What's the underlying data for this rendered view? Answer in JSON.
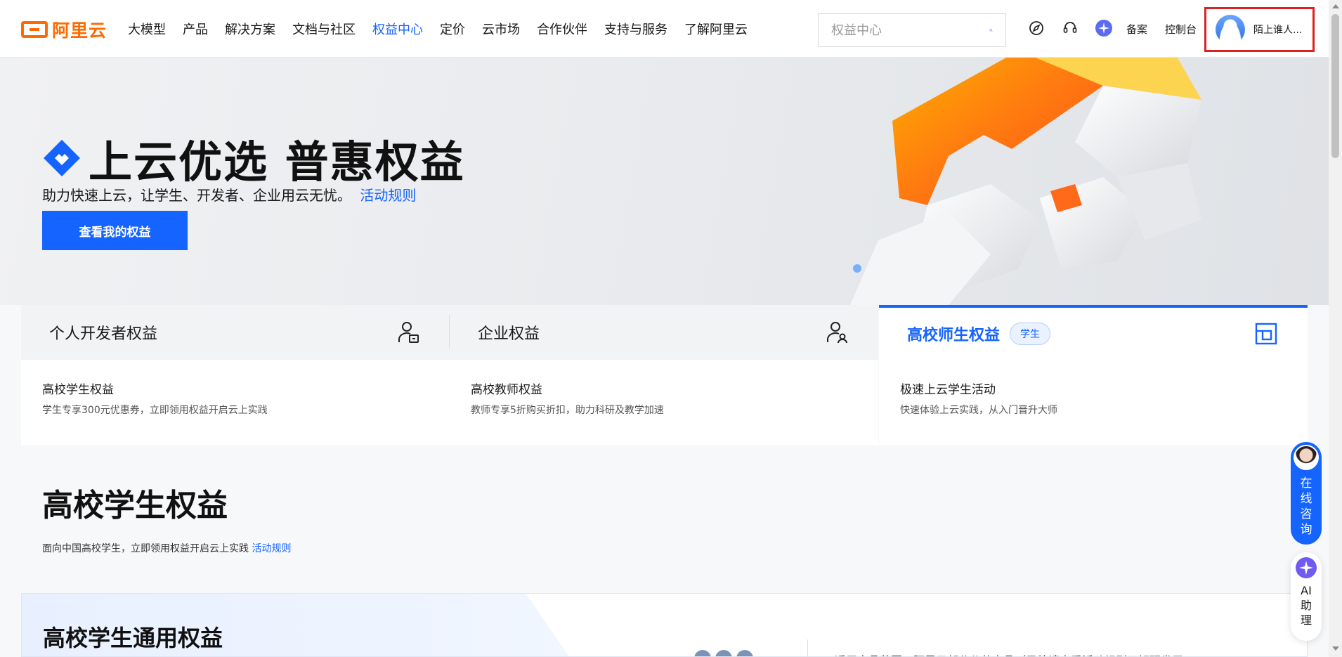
{
  "header": {
    "logo_text": "阿里云",
    "nav": [
      {
        "label": "大模型"
      },
      {
        "label": "产品"
      },
      {
        "label": "解决方案"
      },
      {
        "label": "文档与社区"
      },
      {
        "label": "权益中心",
        "active": true
      },
      {
        "label": "定价"
      },
      {
        "label": "云市场"
      },
      {
        "label": "合作伙伴"
      },
      {
        "label": "支持与服务"
      },
      {
        "label": "了解阿里云"
      }
    ],
    "search": {
      "placeholder": "权益中心",
      "value": ""
    },
    "icons": [
      "explore-icon",
      "support-icon",
      "ai-assistant-icon"
    ],
    "beian_label": "备案",
    "console_label": "控制台",
    "user_name": "陌上谁人..."
  },
  "hero": {
    "title": "上云优选  普惠权益",
    "subtitle": "助力快速上云，让学生、开发者、企业用云无忧。",
    "rules_link": "活动规则",
    "cta_label": "查看我的权益"
  },
  "tabs": [
    {
      "title": "个人开发者权益",
      "item_title": "高校学生权益",
      "item_desc": "学生专享300元优惠券，立即领用权益开启云上实践",
      "active": false
    },
    {
      "title": "企业权益",
      "item_title": "高校教师权益",
      "item_desc": "教师专享5折购买折扣，助力科研及教学加速",
      "active": false
    },
    {
      "title": "高校师生权益",
      "badge": "学生",
      "item_title": "极速上云学生活动",
      "item_desc": "快速体验上云实践，从入门晋升大师",
      "active": true
    }
  ],
  "section": {
    "title": "高校学生权益",
    "desc": "面向中国高校学生，立即领用权益开启云上实践",
    "rules_link": "活动规则"
  },
  "card": {
    "title": "高校学生通用权益",
    "cut_text": "适用产品范围：阿里云部分公共产品（另外请查看活动规则了解研发用"
  },
  "floating": {
    "consult_label": "在线咨询",
    "ai_label": "AI助理"
  },
  "colors": {
    "brand_orange": "#ff6a00",
    "accent_blue": "#1664ff",
    "highlight_red": "#e02020"
  }
}
